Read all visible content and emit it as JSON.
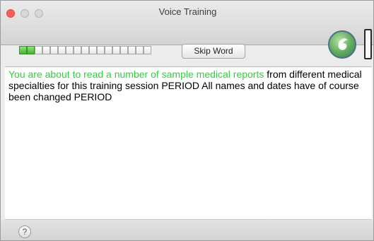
{
  "window": {
    "title": "Voice Training"
  },
  "progress": {
    "completed": 2,
    "total": 17
  },
  "buttons": {
    "skip_word": "Skip Word",
    "help": "?"
  },
  "training_text": {
    "spoken": "You are about to read a number of sample medical reports",
    "remaining": " from different medical specialties for this training session PERIOD All names and dates have of course been changed PERIOD"
  },
  "colors": {
    "spoken_text": "#2ed13b",
    "progress_done": "#46b234",
    "close_button": "#fc5f57"
  },
  "icons": {
    "app_logo": "dragon-logo-icon",
    "mic_level": "audio-level-meter-icon"
  }
}
